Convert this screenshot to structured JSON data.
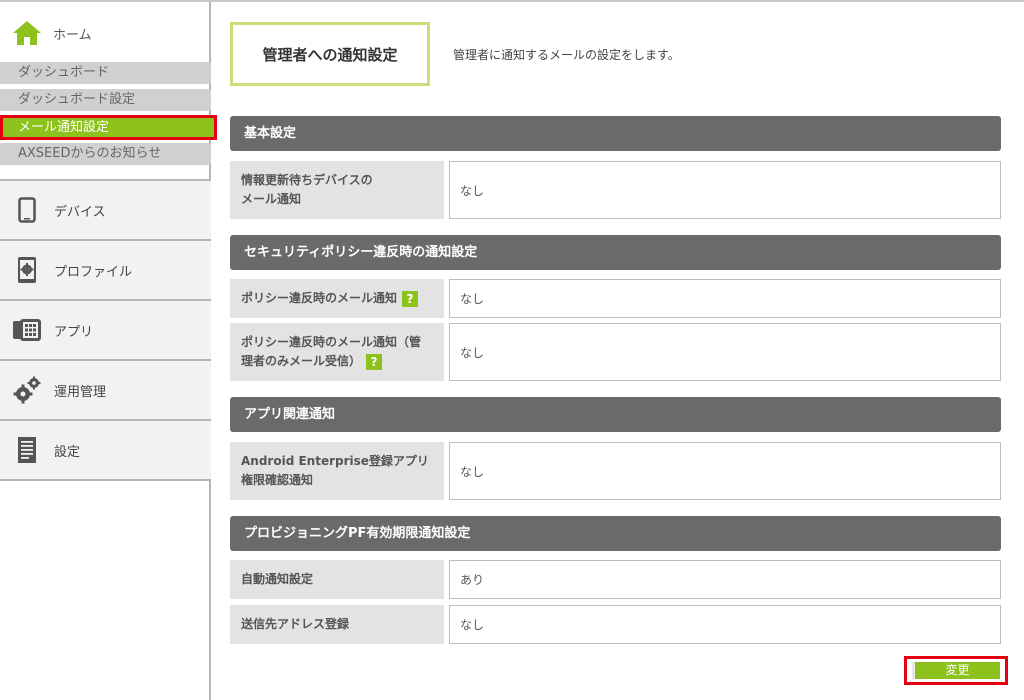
{
  "sidebar": {
    "home_label": "ホーム",
    "sub_items": [
      {
        "label": "ダッシュボード"
      },
      {
        "label": "ダッシュボード設定"
      },
      {
        "label": "メール通知設定"
      },
      {
        "label": "AXSEEDからのお知らせ"
      }
    ],
    "nav_items": [
      {
        "label": "デバイス",
        "icon": "smartphone-icon"
      },
      {
        "label": "プロファイル",
        "icon": "profile-gear-icon"
      },
      {
        "label": "アプリ",
        "icon": "apps-icon"
      },
      {
        "label": "運用管理",
        "icon": "gears-icon"
      },
      {
        "label": "設定",
        "icon": "document-icon"
      }
    ]
  },
  "main": {
    "title": "管理者への通知設定",
    "description": "管理者に通知するメールの設定をします。",
    "sections": [
      {
        "header": "基本設定",
        "rows": [
          {
            "label_line1": "情報更新待ちデバイスの",
            "label_line2": "メール通知",
            "value": "なし"
          }
        ]
      },
      {
        "header": "セキュリティポリシー違反時の通知設定",
        "rows": [
          {
            "label_line1": "ポリシー違反時のメール通知",
            "value": "なし"
          },
          {
            "label_line1": "ポリシー違反時のメール通知（管",
            "label_line2": "理者のみメール受信）",
            "value": "なし"
          }
        ]
      },
      {
        "header": "アプリ関連通知",
        "rows": [
          {
            "label_line1": "Android Enterprise登録アプリ",
            "label_line2": "権限確認通知",
            "value": "なし"
          }
        ]
      },
      {
        "header": "プロビジョニングPF有効期限通知設定",
        "rows": [
          {
            "label_line1": "自動通知設定",
            "value": "あり"
          },
          {
            "label_line1": "送信先アドレス登録",
            "value": "なし"
          }
        ]
      }
    ],
    "help_mark": "?",
    "change_button": "変更"
  },
  "colors": {
    "accent_green": "#8cc21b",
    "highlight_red": "#e60012",
    "section_header": "#6a6a6a"
  }
}
